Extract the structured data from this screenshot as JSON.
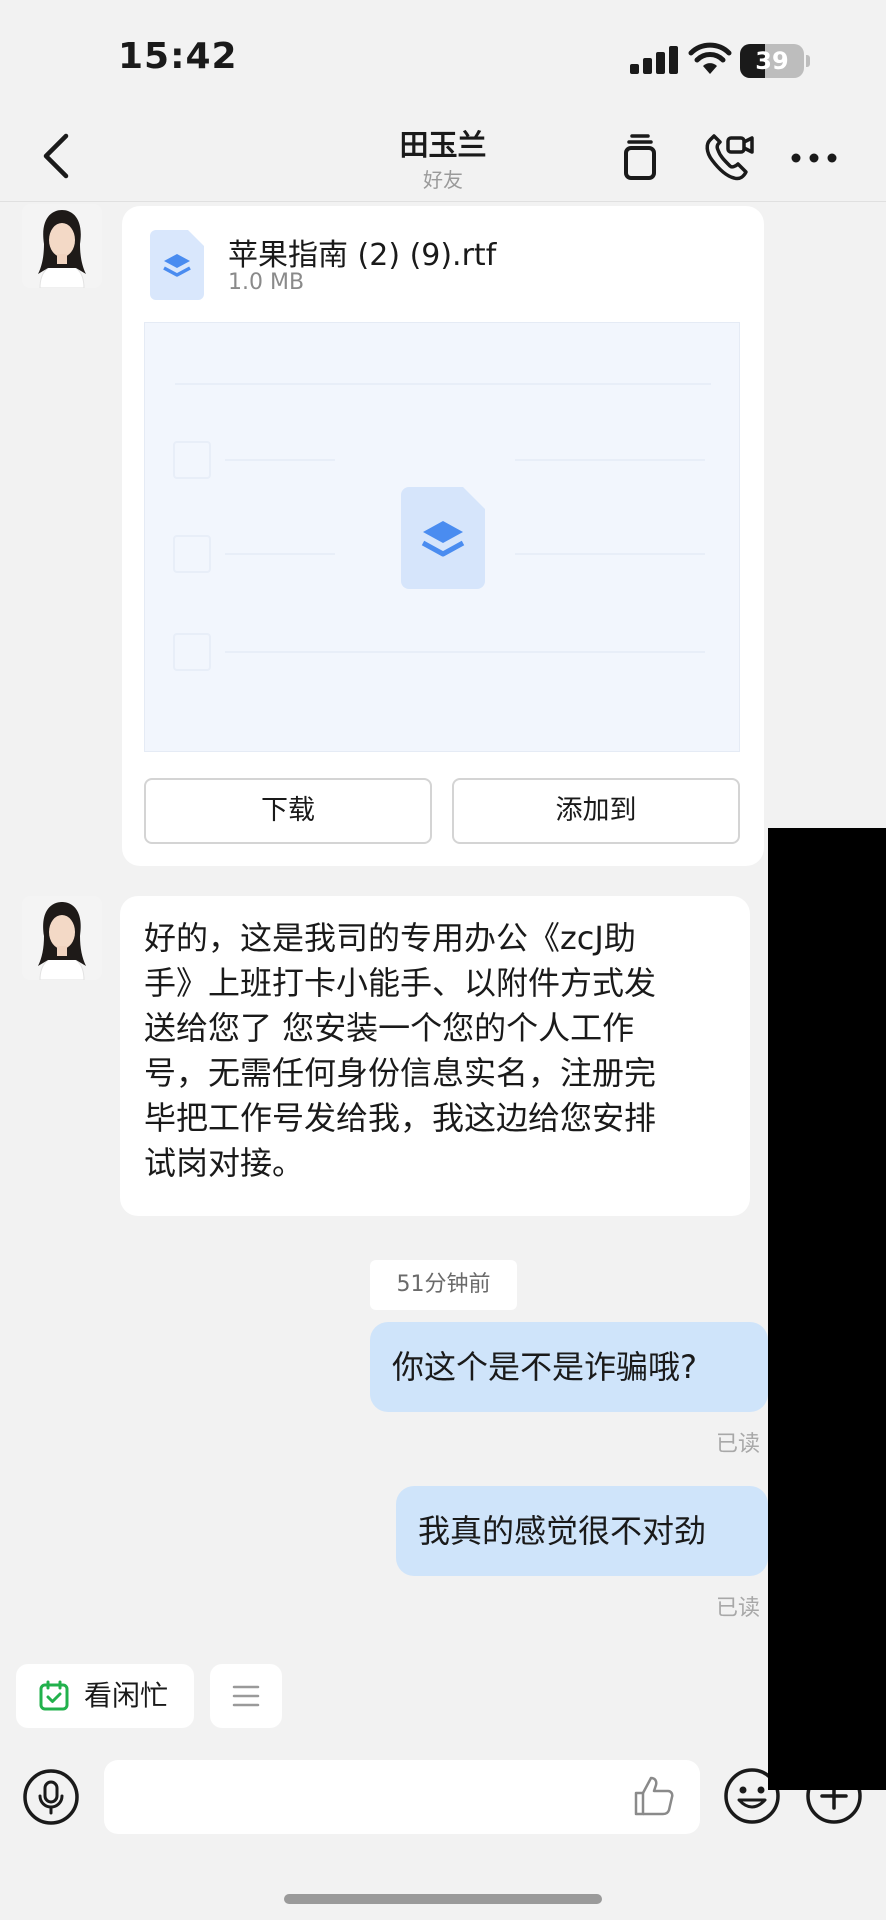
{
  "status_bar": {
    "time": "15:42",
    "battery_level": "39",
    "battery_fraction": 0.39,
    "signal_icon": "cellular-signal-icon",
    "wifi_icon": "wifi-icon"
  },
  "header": {
    "title": "田玉兰",
    "subtitle": "好友",
    "back_icon": "chevron-left-icon",
    "actions": [
      "copy-pages-icon",
      "video-call-icon",
      "more-dots-icon"
    ]
  },
  "messages": {
    "file_card": {
      "file_name": "苹果指南 (2) (9).rtf",
      "file_size": "1.0 MB",
      "icon": "file-layers-icon",
      "download_label": "下载",
      "add_to_label": "添加到"
    },
    "text_message": {
      "lines": [
        "好的，这是我司的专用办公《zcJ助",
        "手》上班打卡小能手、以附件方式发",
        "送给您了 您安装一个您的个人工作",
        "号，无需任何身份信息实名，注册完",
        "毕把工作号发给我，我这边给您安排",
        "试岗对接。"
      ]
    },
    "timestamp": "51分钟前",
    "outgoing": [
      {
        "text": "你这个是不是诈骗哦?",
        "status": "已读"
      },
      {
        "text": "我真的感觉很不对劲",
        "status": "已读"
      }
    ]
  },
  "quick_actions": {
    "availability_label": "看闲忙",
    "availability_icon": "calendar-check-icon",
    "menu_icon": "menu-lines-icon"
  },
  "input_bar": {
    "placeholder": "",
    "icons": [
      "microphone-icon",
      "thumbs-up-icon",
      "emoji-icon",
      "plus-icon"
    ]
  },
  "colors": {
    "background": "#f2f2f2",
    "outgoing_bubble": "#cfe4fa",
    "incoming_bubble": "#ffffff",
    "file_icon_blue": "#4a8cf0",
    "calendar_green": "#22b14c"
  }
}
